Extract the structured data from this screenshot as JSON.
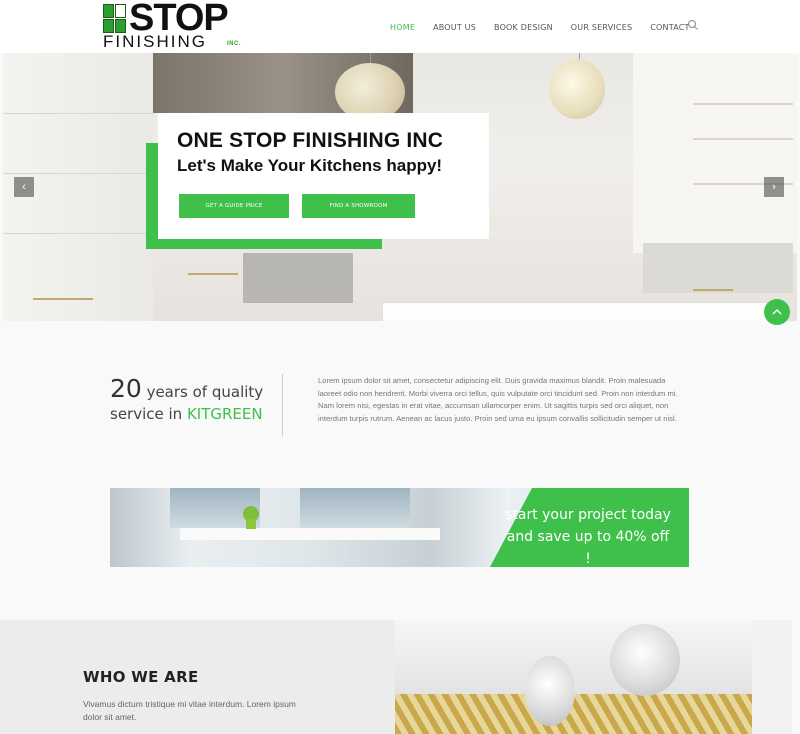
{
  "brand": {
    "logo_top": "STOP",
    "logo_bottom": "FINISHING",
    "logo_suffix": "INC."
  },
  "nav": {
    "items": [
      {
        "label": "HOME",
        "active": true
      },
      {
        "label": "ABOUT US",
        "active": false
      },
      {
        "label": "BOOK DESIGN",
        "active": false
      },
      {
        "label": "OUR SERVICES",
        "active": false
      },
      {
        "label": "CONTACT",
        "active": false
      }
    ]
  },
  "hero": {
    "title": "ONE STOP FINISHING INC",
    "subtitle": "Let's Make Your Kitchens happy!",
    "button_guide": "GET A GUIDE PRICE",
    "button_showroom": "FIND A SHOWROOM",
    "arrow_left": "‹",
    "arrow_right": "›",
    "scroll_top": "︿"
  },
  "quality": {
    "number": "20",
    "line1_rest": " years of quality",
    "line2_prefix": "service in ",
    "line2_brand": "KITGREEN",
    "paragraph": "Lorem ipsum dolor sit amet, consectetur adipiscing elit. Duis gravida maximus blandit. Proin malesuada laoreet odio non hendrerit. Morbi viverra orci tellus, quis vulputate orci tincidunt sed. Proin non interdum mi. Nam lorem nisi, egestas in erat vitae, accumsan ullamcorper enim. Ut sagittis turpis sed orci aliquet, non interdum turpis rutrum. Aenean ac lacus justo. Proin sed urna eu ipsum convallis sollicitudin semper ut nisl."
  },
  "promo": {
    "line1": "start your project today",
    "line2": "and save up to 40% off !"
  },
  "who": {
    "title": "WHO WE ARE",
    "text": "Vivamus dictum tristique mi vitae interdum. Lorem ipsum dolor sit amet."
  },
  "colors": {
    "accent": "#3ec04a",
    "text_dark": "#111111",
    "text_muted": "#777777"
  }
}
